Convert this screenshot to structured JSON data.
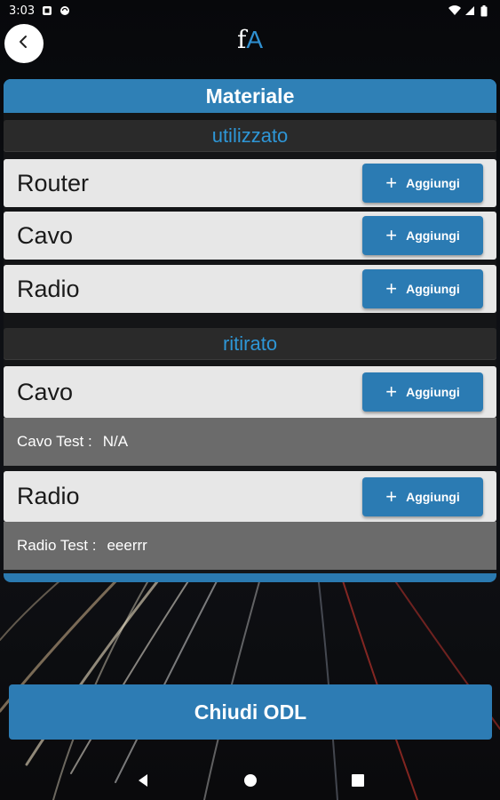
{
  "status_bar": {
    "time": "3:03"
  },
  "header": {
    "logo_f": "f",
    "logo_a": "A"
  },
  "panel": {
    "title": "Materiale",
    "sections": {
      "used": {
        "title": "utilizzato",
        "items": [
          {
            "label": "Router",
            "add_label": "Aggiungi"
          },
          {
            "label": "Cavo",
            "add_label": "Aggiungi"
          },
          {
            "label": "Radio",
            "add_label": "Aggiungi"
          }
        ]
      },
      "removed": {
        "title": "ritirato",
        "items": [
          {
            "label": "Cavo",
            "add_label": "Aggiungi",
            "detail_label": "Cavo Test :",
            "detail_value": "N/A"
          },
          {
            "label": "Radio",
            "add_label": "Aggiungi",
            "detail_label": "Radio Test :",
            "detail_value": "eeerrr"
          }
        ]
      }
    }
  },
  "footer": {
    "close_label": "Chiudi ODL"
  },
  "colors": {
    "accent": "#2b7bb3",
    "section_text": "#2e96d6",
    "row_bg": "#e7e7e7"
  }
}
